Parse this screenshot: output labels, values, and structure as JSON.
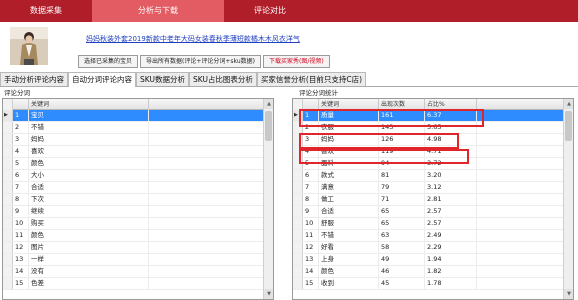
{
  "nav": {
    "items": [
      {
        "label": "数据采集"
      },
      {
        "label": "分析与下载"
      },
      {
        "label": "评论对比"
      }
    ]
  },
  "product": {
    "title": "妈妈秋装外套2019新款中老年大码女装春秋季薄短款橘木木风衣洋气",
    "actions": [
      {
        "label": "选择已采集的宝贝"
      },
      {
        "label": "导出所有数据(评论+评论分词+sku数据)"
      },
      {
        "label": "下载买家秀(图/视频)"
      }
    ]
  },
  "tabs": [
    {
      "label": "手动分析评论内容"
    },
    {
      "label": "自动分词评论内容"
    },
    {
      "label": "SKU数据分析"
    },
    {
      "label": "SKU占比图表分析"
    },
    {
      "label": "买家信誉分析(目前只支持C店)"
    }
  ],
  "left": {
    "group_label": "评论分词",
    "header": {
      "word": "关键词"
    },
    "rows": [
      {
        "rank": "1",
        "word": "宝贝",
        "ind": "▶"
      },
      {
        "rank": "2",
        "word": "不错",
        "ind": ""
      },
      {
        "rank": "3",
        "word": "妈妈",
        "ind": ""
      },
      {
        "rank": "4",
        "word": "喜欢",
        "ind": ""
      },
      {
        "rank": "5",
        "word": "颜色",
        "ind": ""
      },
      {
        "rank": "6",
        "word": "大小",
        "ind": ""
      },
      {
        "rank": "7",
        "word": "合适",
        "ind": ""
      },
      {
        "rank": "8",
        "word": "下次",
        "ind": ""
      },
      {
        "rank": "9",
        "word": "继续",
        "ind": ""
      },
      {
        "rank": "10",
        "word": "购买",
        "ind": ""
      },
      {
        "rank": "11",
        "word": "颜色",
        "ind": ""
      },
      {
        "rank": "12",
        "word": "图片",
        "ind": ""
      },
      {
        "rank": "13",
        "word": "一样",
        "ind": ""
      },
      {
        "rank": "14",
        "word": "没有",
        "ind": ""
      },
      {
        "rank": "15",
        "word": "色差",
        "ind": ""
      }
    ]
  },
  "right": {
    "group_label": "评论分词统计",
    "header": {
      "word": "关键词",
      "count": "出现次数",
      "pct": "占比%"
    },
    "rows": [
      {
        "rank": "1",
        "word": "质量",
        "count": "161",
        "pct": "6.37",
        "ind": "▶"
      },
      {
        "rank": "2",
        "word": "衣服",
        "count": "143",
        "pct": "5.65",
        "ind": ""
      },
      {
        "rank": "3",
        "word": "妈妈",
        "count": "126",
        "pct": "4.98",
        "ind": ""
      },
      {
        "rank": "4",
        "word": "喜欢",
        "count": "119",
        "pct": "4.71",
        "ind": ""
      },
      {
        "rank": "5",
        "word": "面料",
        "count": "94",
        "pct": "3.72",
        "ind": ""
      },
      {
        "rank": "6",
        "word": "款式",
        "count": "81",
        "pct": "3.20",
        "ind": ""
      },
      {
        "rank": "7",
        "word": "满意",
        "count": "79",
        "pct": "3.12",
        "ind": ""
      },
      {
        "rank": "8",
        "word": "做工",
        "count": "71",
        "pct": "2.81",
        "ind": ""
      },
      {
        "rank": "9",
        "word": "合适",
        "count": "65",
        "pct": "2.57",
        "ind": ""
      },
      {
        "rank": "10",
        "word": "舒服",
        "count": "65",
        "pct": "2.57",
        "ind": ""
      },
      {
        "rank": "11",
        "word": "不错",
        "count": "63",
        "pct": "2.49",
        "ind": ""
      },
      {
        "rank": "12",
        "word": "好看",
        "count": "58",
        "pct": "2.29",
        "ind": ""
      },
      {
        "rank": "13",
        "word": "上身",
        "count": "49",
        "pct": "1.94",
        "ind": ""
      },
      {
        "rank": "14",
        "word": "颜色",
        "count": "46",
        "pct": "1.82",
        "ind": ""
      },
      {
        "rank": "15",
        "word": "收到",
        "count": "45",
        "pct": "1.78",
        "ind": ""
      }
    ]
  },
  "colors": {
    "nav_bg": "#b01e2a",
    "nav_active": "#e35b63",
    "selection": "#2f8cff",
    "highlight": "#e0252b",
    "link": "#1f3fbf"
  }
}
